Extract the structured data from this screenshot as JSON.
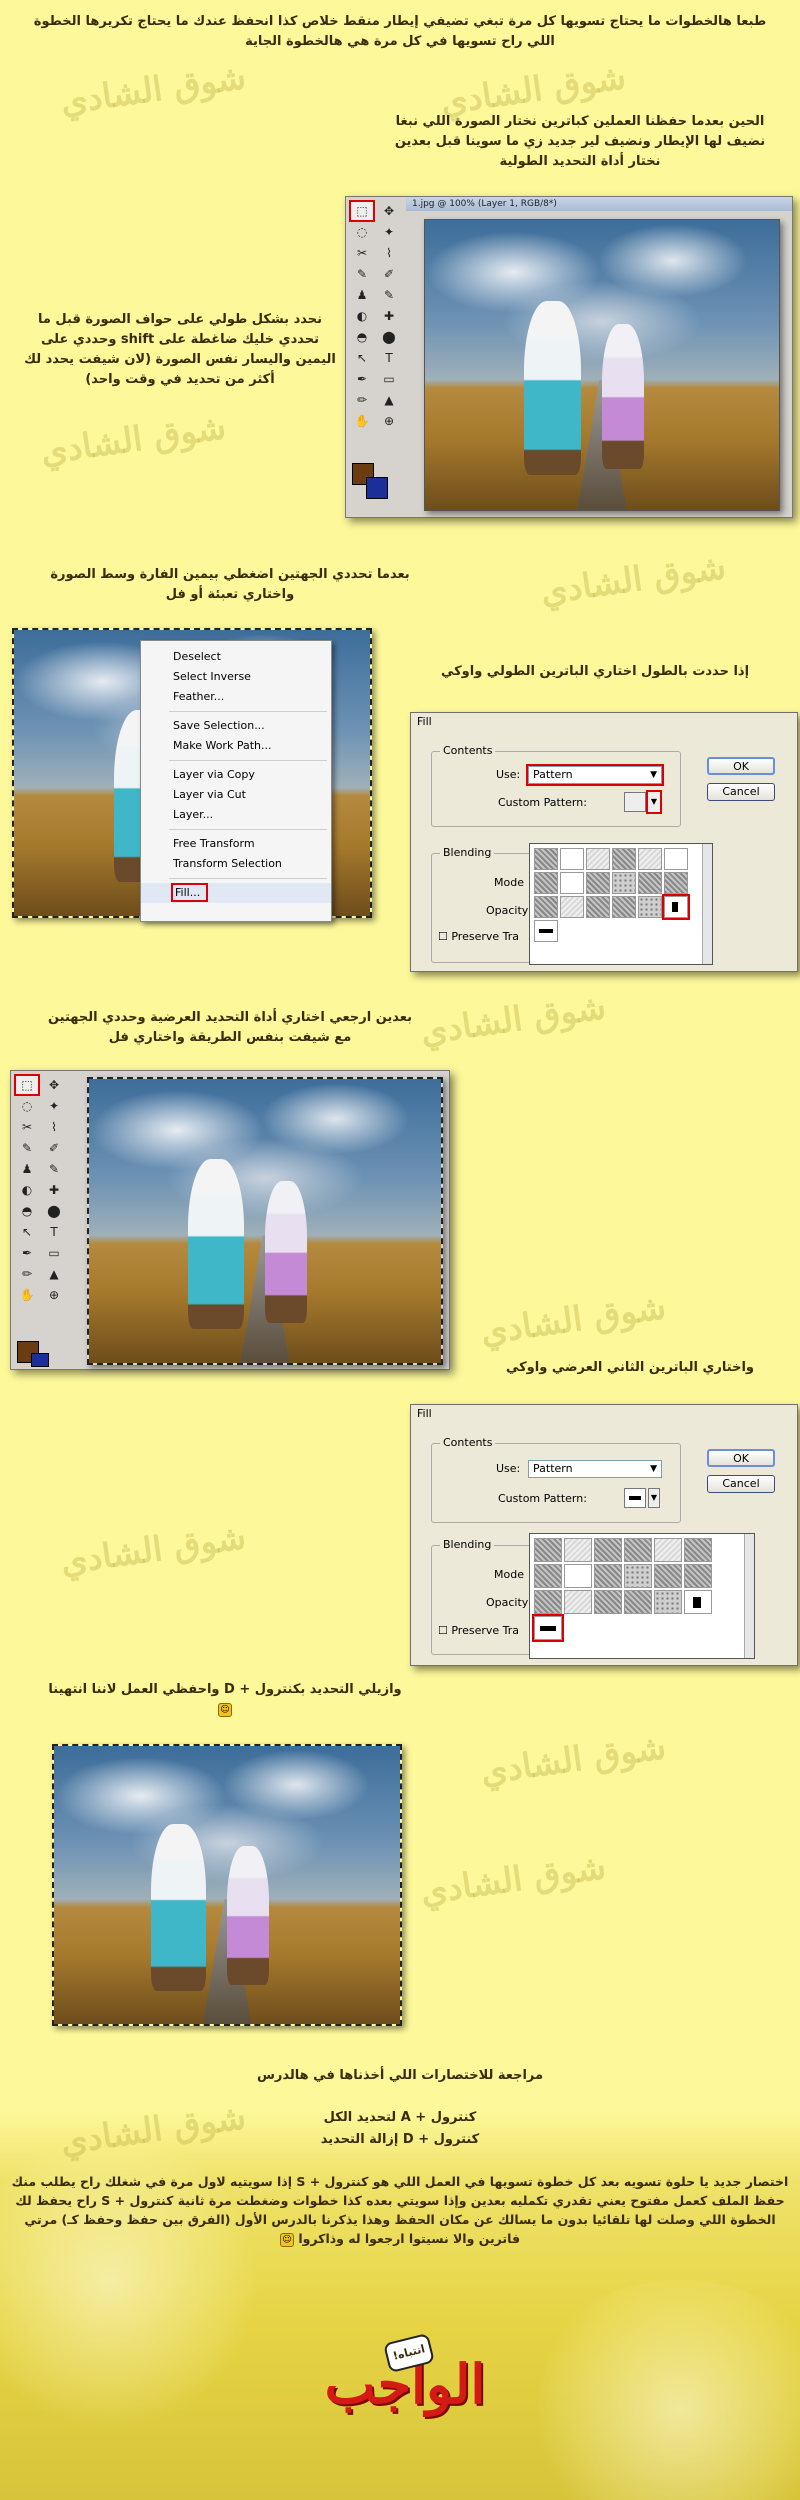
{
  "steps": {
    "intro": "طبعا هالخطوات ما يحتاج تسويها كل مرة تبغي تضيفي إيطار منقط خلاص كذا انحفظ عندك ما يحتاج تكريرها الخطوة اللي راح تسويها في كل مرة هي هالخطوة الجاية",
    "step1": "الحين بعدما حفظنا العملين كباترين نختار الصورة اللي نبغا نضيف لها الإيطار ونضيف لير جديد زي ما سوينا قبل بعدين نختار أداة التحديد الطولية",
    "step2": "نحدد بشكل طولي على حواف الصورة قبل ما تحددي خليك ضاغطة على shift وحددي على اليمين واليسار نفس الصورة (لان شيفت يحدد لك أكثر من تحديد في وقت واحد)",
    "step3": "بعدما تحددي الجهتين اضغطي بيمين الفارة وسط الصورة واختاري تعبئة أو فل",
    "step4": "إذا حددت بالطول اختاري الباترين الطولي واوكي",
    "step5": "بعدين ارجعي اختاري أداة التحديد العرضية وحددي الجهتين مع شيفت بنفس الطريقة واختاري فل",
    "step6": "واختاري الباترين الثاني العرضي واوكي",
    "step7": "وازيلي التحديد بكنترول + D واحفظي العمل لاننا انتهينا",
    "summary_title": "مراجعة للاختصارات اللي أخذناها في هالدرس",
    "shortcut1": "كنترول + A لتحديد الكل",
    "shortcut2": "كنترول + D إزالة التحديد",
    "tip": "اختصار جديد يا حلوة تسويه بعد كل خطوة تسويها في العمل اللي هو كنترول + S إذا سويتيه لاول مرة في شغلك راح يطلب منك حفظ الملف كعمل مفتوح يعني تقدري تكمليه بعدين وإذا سويتي بعده كذا خطوات وضغطت مرة ثانية كنترول + S راح يحفظ لك الخطوة اللي وصلت لها تلقائيا بدون ما يسالك عن مكان الحفظ وهذا يذكرنا بالدرس الأول (الفرق بين حفظ وحفظ كـ) مرتي فاترين والا نسيتوا ارجعوا له وذاكروا"
  },
  "ps_window": {
    "title": "1.jpg @ 100% (Layer 1, RGB/8*)"
  },
  "context_menu": {
    "items": [
      "Deselect",
      "Select Inverse",
      "Feather...",
      "Save Selection...",
      "Make Work Path...",
      "Layer via Copy",
      "Layer via Cut",
      "Layer...",
      "Free Transform",
      "Transform Selection",
      "Fill..."
    ]
  },
  "fill_dialog_1": {
    "title": "Fill",
    "contents_label": "Contents",
    "use_label": "Use:",
    "use_value": "Pattern",
    "custom_pattern_label": "Custom Pattern:",
    "ok": "OK",
    "cancel": "Cancel",
    "blending_label": "Blending",
    "mode_label": "Mode",
    "opacity_label": "Opacity",
    "preserve_label": "Preserve Tra"
  },
  "fill_dialog_2": {
    "title": "Fill",
    "contents_label": "Contents",
    "use_label": "Use:",
    "use_value": "Pattern",
    "custom_pattern_label": "Custom Pattern:",
    "ok": "OK",
    "cancel": "Cancel",
    "blending_label": "Blending",
    "mode_label": "Mode",
    "opacity_label": "Opacity",
    "preserve_label": "Preserve Tra"
  },
  "tools": [
    "⬚",
    "✥",
    "◌",
    "✦",
    "✂",
    "⌇",
    "✎",
    "✐",
    "♟",
    "✎",
    "◐",
    "✚",
    "✏",
    "◓",
    "▲",
    "⬤",
    "↖",
    "T",
    "✒",
    "▭",
    "✋",
    "🔍"
  ],
  "logo": {
    "text": "الواجب",
    "badge": "انتباه!"
  },
  "watermark": "شوق الشادي",
  "colors": {
    "background": "#fdf89a",
    "text": "#3b2a08",
    "highlight_box": "#dd0000",
    "logo_red": "#d41a14"
  }
}
